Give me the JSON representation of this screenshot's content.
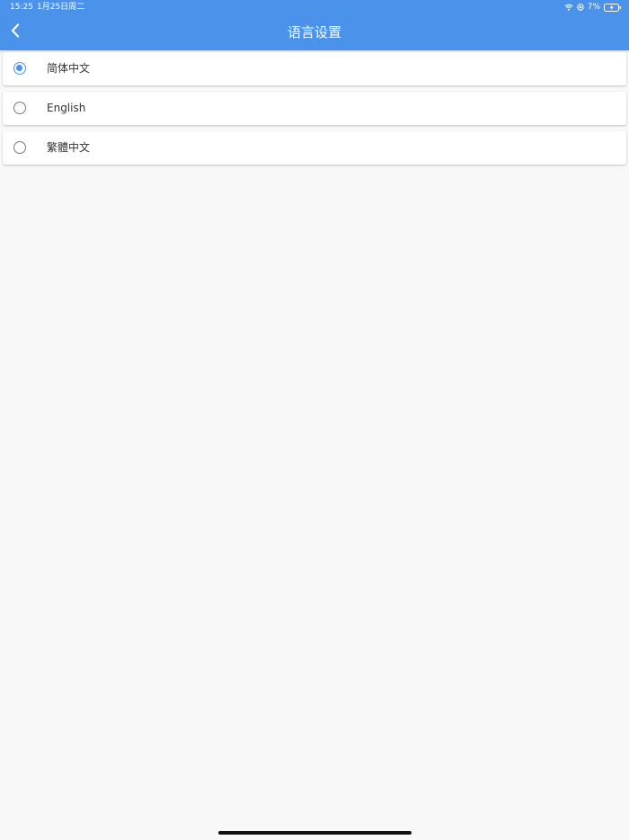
{
  "status_bar": {
    "time": "15:25",
    "date": "1月25日周二",
    "battery_percent": "7%",
    "icons": [
      "wifi-icon",
      "location-icon",
      "battery-charging-icon"
    ]
  },
  "header": {
    "title": "语言设置",
    "back_icon": "chevron-left-icon"
  },
  "languages": [
    {
      "label": "简体中文",
      "selected": true
    },
    {
      "label": "English",
      "selected": false
    },
    {
      "label": "繁體中文",
      "selected": false
    }
  ],
  "colors": {
    "accent": "#4a92ea",
    "background": "#f8f8f8"
  }
}
